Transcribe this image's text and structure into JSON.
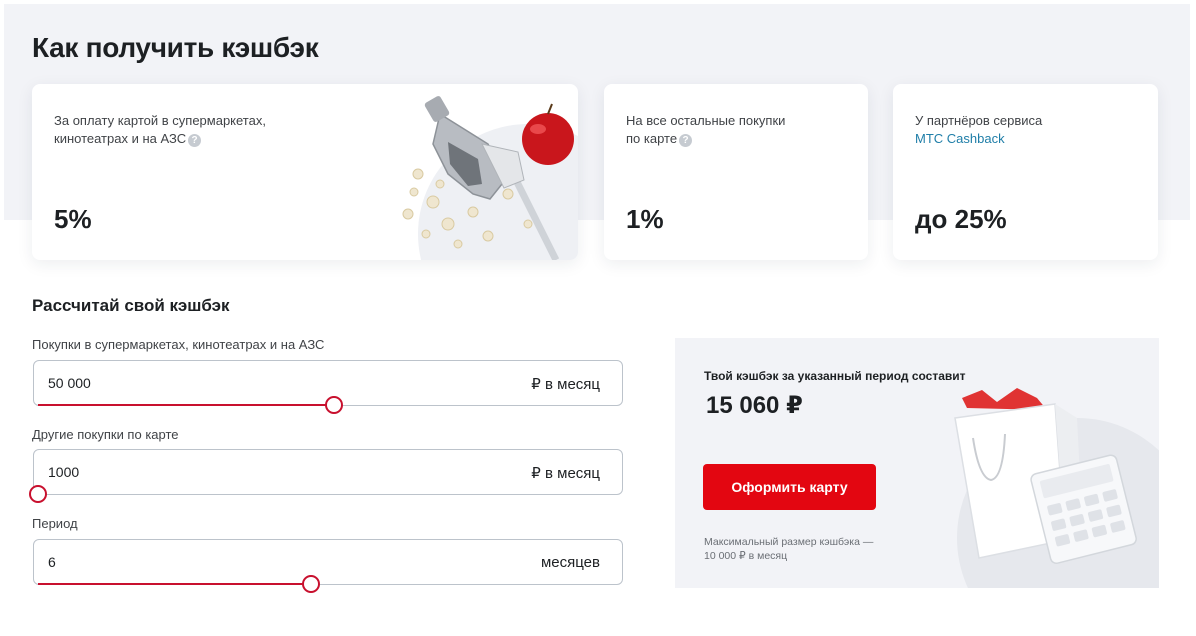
{
  "page": {
    "title": "Как получить кэшбэк"
  },
  "cards": [
    {
      "desc_line1": "За оплату картой в супермаркетах,",
      "desc_line2": "кинотеатрах и на АЗС",
      "value": "5%",
      "help_icon": "question-icon"
    },
    {
      "desc_line1": "На все остальные покупки",
      "desc_line2": "по карте",
      "value": "1%",
      "help_icon": "question-icon"
    },
    {
      "desc_line1": "У партнёров сервиса",
      "link": "МТС Cashback",
      "value": "до 25%"
    }
  ],
  "calculator": {
    "title": "Рассчитай свой кэшбэк",
    "fields": [
      {
        "label": "Покупки в супермаркетах, кинотеатрах и на АЗС",
        "value": "50 000",
        "unit": "₽ в месяц",
        "slider_fraction": 0.51
      },
      {
        "label": "Другие покупки по карте",
        "value": "1000",
        "unit": "₽ в месяц",
        "slider_fraction": 0.0
      },
      {
        "label": "Период",
        "value": "6",
        "unit": "месяцев",
        "slider_fraction": 0.47
      }
    ]
  },
  "result": {
    "label": "Твой кэшбэк за указанный период составит",
    "value": "15 060 ₽",
    "button": "Оформить карту",
    "note_line1": "Максимальный размер кэшбэка —",
    "note_line2": "10 000 ₽ в месяц"
  },
  "colors": {
    "accent": "#e30611",
    "slider": "#c8102e",
    "panel_bg": "#f2f3f7",
    "link": "#1f7ea8"
  }
}
